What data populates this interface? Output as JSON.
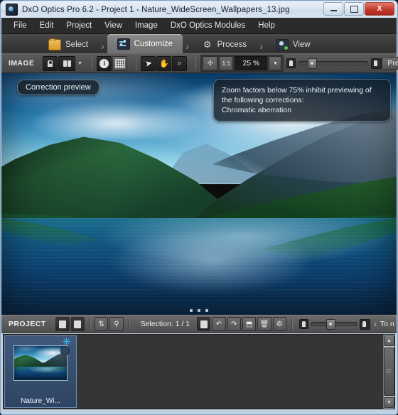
{
  "window": {
    "title": "DxO Optics Pro 6.2 - Project 1 - Nature_WideScreen_Wallpapers_13.jpg",
    "app_icon": "dxo-app-icon",
    "controls": {
      "minimize": "minimize-button",
      "maximize": "maximize-button",
      "close_label": "X"
    }
  },
  "menubar": {
    "items": [
      {
        "label": "File"
      },
      {
        "label": "Edit"
      },
      {
        "label": "Project"
      },
      {
        "label": "View"
      },
      {
        "label": "Image"
      },
      {
        "label": "DxO Optics Modules"
      },
      {
        "label": "Help"
      }
    ]
  },
  "tabs": {
    "separator": "›",
    "items": [
      {
        "label": "Select",
        "icon": "folder-icon",
        "active": false
      },
      {
        "label": "Customize",
        "icon": "sliders-icon",
        "active": true
      },
      {
        "label": "Process",
        "icon": "gears-icon",
        "active": false
      },
      {
        "label": "View",
        "icon": "image-check-icon",
        "active": false
      }
    ]
  },
  "toolbar": {
    "section_label": "IMAGE",
    "view_single": "single-view-button",
    "view_compare": "compare-view-button",
    "view_dropdown_caret": "▼",
    "info_button": "i",
    "grid_button": "grid-button",
    "tool_pointer": "➤",
    "tool_hand": "✋",
    "tool_zoom": "⌕",
    "fit_button": "fit-to-window-button",
    "one_to_one": "1:1",
    "zoom_value": "25 %",
    "zoom_caret": "▼",
    "presets_label": "Presets",
    "presets_caret": "▼"
  },
  "viewer": {
    "correction_preview_badge": "Correction preview",
    "notice": "Zoom factors below 75% inhibit previewing of the following corrections:\nChromatic aberration",
    "notice_line1": "Zoom factors below 75% inhibit previewing of",
    "notice_line2": "the following corrections:",
    "notice_line3": "Chromatic aberration",
    "photo_alt": "mountain-lake-reflection-photo"
  },
  "projectbar": {
    "section_label": "PROJECT",
    "selection_text": "Selection: 1 / 1",
    "buttons": [
      {
        "name": "image-info-button",
        "glyph": "ⓘ"
      },
      {
        "name": "add-image-button",
        "glyph": "➕"
      },
      {
        "name": "sort-button",
        "glyph": "⇅"
      },
      {
        "name": "filter-button",
        "glyph": "⚲"
      },
      {
        "name": "rename-button",
        "glyph": "ⓘ"
      },
      {
        "name": "undo-button",
        "glyph": "↶"
      },
      {
        "name": "redo-button",
        "glyph": "↷"
      },
      {
        "name": "select-all-button",
        "glyph": "⬒"
      },
      {
        "name": "delete-button",
        "glyph": "🗑"
      },
      {
        "name": "settings-button",
        "glyph": "⚙"
      }
    ],
    "size_chevron": "›",
    "trailing_text": "To n"
  },
  "filmstrip": {
    "items": [
      {
        "name": "Nature_Wi...",
        "selected": true,
        "star_badge": "✳",
        "status_badge": "processing-dot"
      }
    ],
    "scrollbar": {
      "up": "▲",
      "down": "▼"
    }
  },
  "colors": {
    "accent_cyan": "#39c2ef",
    "tab_active": "#7c7c7c",
    "chrome_dark": "#2b2b2b",
    "selection_blue": "#41597c",
    "close_red": "#c33a2c"
  }
}
